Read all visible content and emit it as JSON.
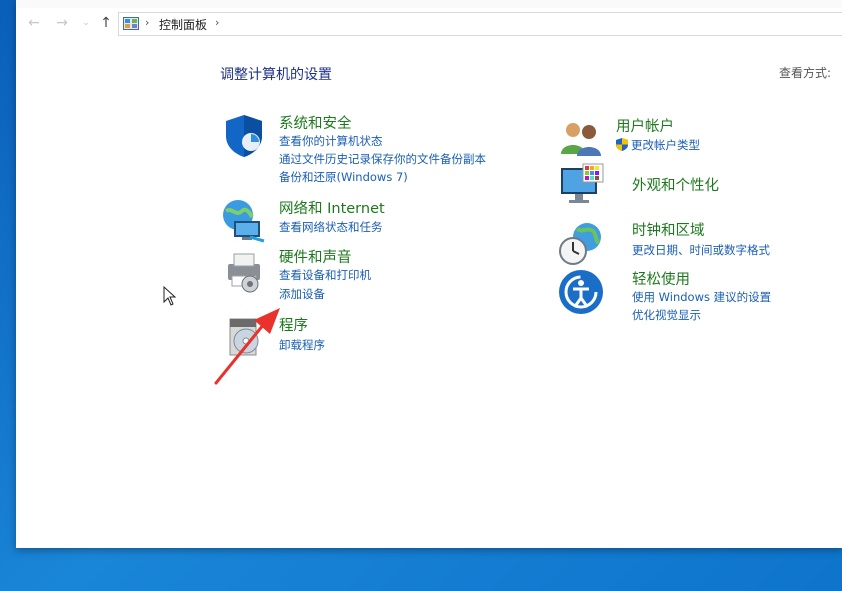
{
  "window": {
    "breadcrumb": {
      "root_label": "控制面板",
      "separator": "›"
    },
    "heading": "调整计算机的设置",
    "view_by_label": "查看方式:",
    "nav": {
      "back_icon": "arrow-left-icon",
      "forward_icon": "arrow-right-icon",
      "dropdown_icon": "chevron-down-icon",
      "up_icon": "arrow-up-icon"
    }
  },
  "categories": {
    "system_security": {
      "title": "系统和安全",
      "links": [
        "查看你的计算机状态",
        "通过文件历史记录保存你的文件备份副本",
        "备份和还原(Windows 7)"
      ]
    },
    "network": {
      "title": "网络和 Internet",
      "links": [
        "查看网络状态和任务"
      ]
    },
    "hardware_sound": {
      "title": "硬件和声音",
      "links": [
        "查看设备和打印机",
        "添加设备"
      ]
    },
    "programs": {
      "title": "程序",
      "links": [
        "卸载程序"
      ]
    },
    "user_accounts": {
      "title": "用户帐户",
      "links": [
        "更改帐户类型"
      ]
    },
    "appearance": {
      "title": "外观和个性化",
      "links": []
    },
    "clock_region": {
      "title": "时钟和区域",
      "links": [
        "更改日期、时间或数字格式"
      ]
    },
    "ease_access": {
      "title": "轻松使用",
      "links": [
        "使用 Windows 建议的设置",
        "优化视觉显示"
      ]
    }
  },
  "colors": {
    "category_title": "#1c7a1c",
    "link": "#1a5fb4",
    "heading": "#1e3287",
    "annotation_arrow": "#e8322b",
    "desktop": "#0e74cc"
  }
}
